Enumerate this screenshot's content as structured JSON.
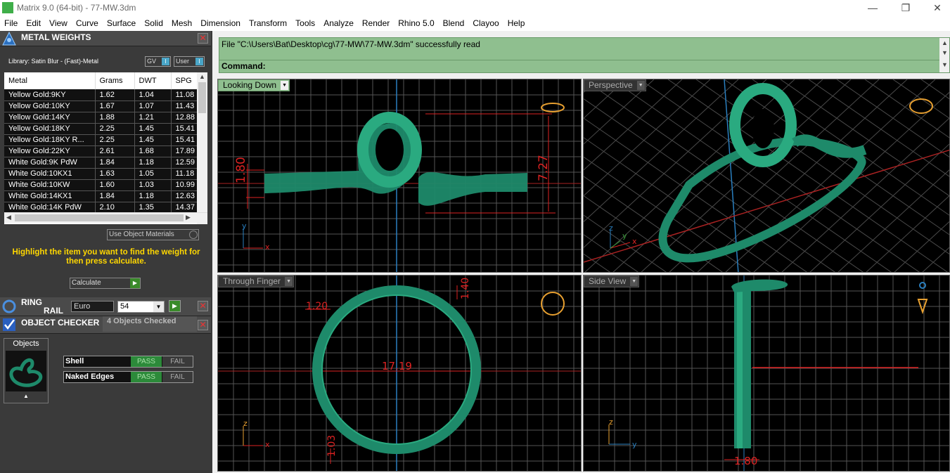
{
  "window": {
    "title": "Matrix 9.0 (64-bit) - 77-MW.3dm",
    "minimize": "—",
    "maximize": "❐",
    "close": "✕"
  },
  "menu": [
    "File",
    "Edit",
    "View",
    "Curve",
    "Surface",
    "Solid",
    "Mesh",
    "Dimension",
    "Transform",
    "Tools",
    "Analyze",
    "Render",
    "Rhino 5.0",
    "Blend",
    "Clayoo",
    "Help"
  ],
  "metal_weights": {
    "title": "METAL WEIGHTS",
    "library": "Library: Satin Blur - (Fast)-Metal",
    "gv_label": "GV",
    "user_label": "User",
    "columns": [
      "Metal",
      "Grams",
      "DWT",
      "SPG"
    ],
    "rows": [
      [
        "Yellow Gold:9KY",
        "1.62",
        "1.04",
        "11.08"
      ],
      [
        "Yellow Gold:10KY",
        "1.67",
        "1.07",
        "11.43"
      ],
      [
        "Yellow Gold:14KY",
        "1.88",
        "1.21",
        "12.88"
      ],
      [
        "Yellow Gold:18KY",
        "2.25",
        "1.45",
        "15.41"
      ],
      [
        "Yellow Gold:18KY R...",
        "2.25",
        "1.45",
        "15.41"
      ],
      [
        "Yellow Gold:22KY",
        "2.61",
        "1.68",
        "17.89"
      ],
      [
        "White Gold:9K PdW",
        "1.84",
        "1.18",
        "12.59"
      ],
      [
        "White Gold:10KX1",
        "1.63",
        "1.05",
        "11.18"
      ],
      [
        "White Gold:10KW",
        "1.60",
        "1.03",
        "10.99"
      ],
      [
        "White Gold:14KX1",
        "1.84",
        "1.18",
        "12.63"
      ],
      [
        "White Gold:14K PdW",
        "2.10",
        "1.35",
        "14.37"
      ]
    ],
    "use_object_materials": "Use Object Materials",
    "instructions": "Highlight the item you want to find the weight for then press calculate.",
    "calculate": "Calculate"
  },
  "ring_rail": {
    "title_line1": "RING",
    "title_line2": "RAIL",
    "standard": "Euro",
    "size": "54"
  },
  "object_checker": {
    "title": "OBJECT CHECKER",
    "status": "4 Objects Checked",
    "objects_label": "Objects",
    "checks": [
      {
        "label": "Shell",
        "pass": "PASS",
        "fail": "FAIL"
      },
      {
        "label": "Naked Edges",
        "pass": "PASS",
        "fail": "FAIL"
      }
    ]
  },
  "command": {
    "message": "File \"C:\\Users\\Bat\\Desktop\\cg\\77-MW\\77-MW.3dm\" successfully read",
    "prompt": "Command:"
  },
  "viewports": {
    "top": {
      "label": "Looking Down",
      "dims": [
        "1.80",
        "7.27"
      ],
      "axes": [
        "y",
        "x"
      ]
    },
    "perspective": {
      "label": "Perspective",
      "axes": [
        "z",
        "y",
        "x"
      ]
    },
    "front": {
      "label": "Through Finger",
      "dims": [
        "1.20",
        "1.40",
        "17.19",
        "1.03"
      ],
      "axes": [
        "z",
        "x"
      ]
    },
    "side": {
      "label": "Side View",
      "dims": [
        "1.80"
      ],
      "axes": [
        "z",
        "y"
      ]
    }
  },
  "colors": {
    "ring_green": "#1e8a6a",
    "dim_red": "#dd2222",
    "grid": "#555555",
    "command_bg": "#8fbf8f"
  }
}
